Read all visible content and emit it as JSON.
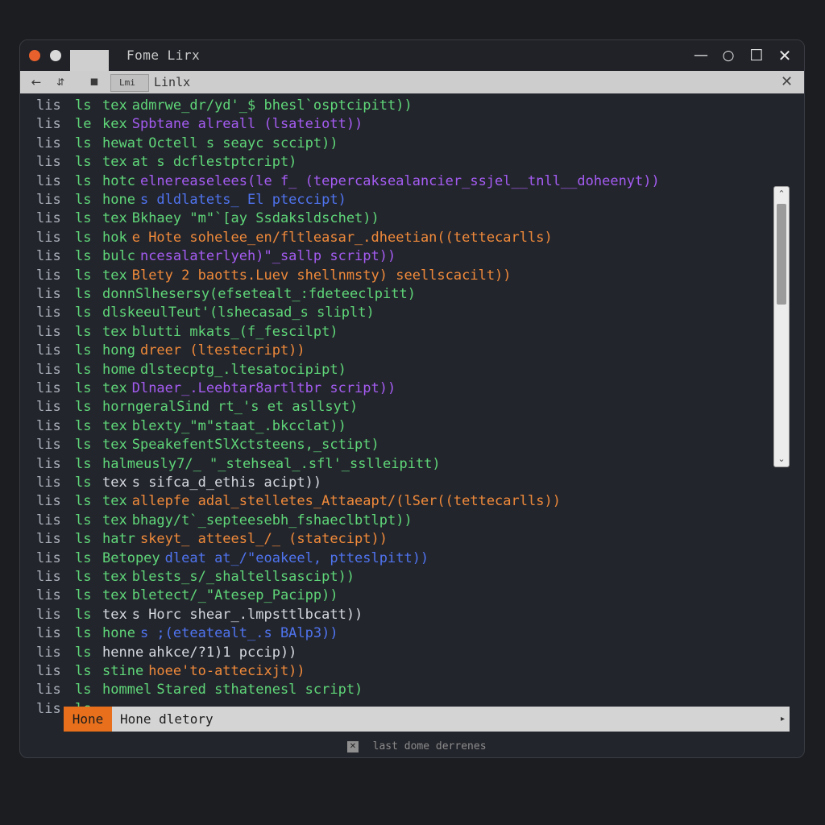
{
  "window": {
    "title": "Fome Lirx",
    "controls": {
      "minimize": "—",
      "restore": "○",
      "maximize": "☐",
      "close": "✕"
    }
  },
  "toolbar": {
    "back": "←",
    "forward": "⇵",
    "view": "◼",
    "tab_text": "Lmi",
    "label": "Linlx",
    "close": "✕"
  },
  "colors": {
    "green": "#5fd779",
    "purple": "#a45cf2",
    "orange": "#f08a3a",
    "blue": "#4f74f0",
    "white": "#d6dae0",
    "accent": "#e8701c"
  },
  "terminal": {
    "lines": [
      {
        "prompt": "lis",
        "cmd": "ls",
        "arg": "tex",
        "rest": "admrwe_dr/yd'_$ bhesl`osptcipitt))",
        "color": "green"
      },
      {
        "prompt": "lis",
        "cmd": "le",
        "arg": "kex",
        "rest": "Spbtane alreall (lsateiott))",
        "color": "purple"
      },
      {
        "prompt": "lis",
        "cmd": "ls",
        "arg": "hewat",
        "rest": "Octell s seayc sccipt))",
        "color": "green"
      },
      {
        "prompt": "lis",
        "cmd": "ls",
        "arg": "tex",
        "rest": "at s dcflestptcript)",
        "color": "green"
      },
      {
        "prompt": "lis",
        "cmd": "ls",
        "arg": "hotc",
        "rest": "elnereaselees(le f_ (tepercaksealancier_ssjel__tnll__doheenyt))",
        "color": "purple"
      },
      {
        "prompt": "lis",
        "cmd": "ls",
        "arg": "hone",
        "rest": "s dldlatets_ El pteccipt)",
        "color": "blue"
      },
      {
        "prompt": "lis",
        "cmd": "ls",
        "arg": "tex",
        "rest": "Bkhaey \"m\"`[ay Ssdaksldschet))",
        "color": "green"
      },
      {
        "prompt": "lis",
        "cmd": "ls",
        "arg": "hok",
        "rest": "e Hote sohelee_en/fltleasar_.dheetian((tettecarlls)",
        "color": "orange"
      },
      {
        "prompt": "lis",
        "cmd": "ls",
        "arg": "bulc",
        "rest": "ncesalaterlyeh)\"_sallp script))",
        "color": "purple"
      },
      {
        "prompt": "lis",
        "cmd": "ls",
        "arg": "tex",
        "rest": "Blety 2 baotts.Luev shellnmsty) seellscacilt))",
        "color": "orange"
      },
      {
        "prompt": "lis",
        "cmd": "ls",
        "arg": "donnSlhesersy(efsetealt_:fdeteeclpitt)",
        "rest": "",
        "color": "green"
      },
      {
        "prompt": "lis",
        "cmd": "ls",
        "arg": "dlskeeulTeut'(lshecasad_s sliplt)",
        "rest": "",
        "color": "green"
      },
      {
        "prompt": "lis",
        "cmd": "ls",
        "arg": "tex",
        "rest": "blutti mkats_(f_fescilpt)",
        "color": "green"
      },
      {
        "prompt": "lis",
        "cmd": "ls",
        "arg": "hong",
        "rest": "dreer (ltestecript))",
        "color": "orange"
      },
      {
        "prompt": "lis",
        "cmd": "ls",
        "arg": "home",
        "rest": "dlstecptg_.ltesatocipipt)",
        "color": "green"
      },
      {
        "prompt": "lis",
        "cmd": "ls",
        "arg": "tex",
        "rest": "Dlnaer_.Leebtar8artltbr script))",
        "color": "purple"
      },
      {
        "prompt": "lis",
        "cmd": "ls",
        "arg": "horngeralSind rt_'s et asllsyt)",
        "rest": "",
        "color": "purple"
      },
      {
        "prompt": "lis",
        "cmd": "ls",
        "arg": "tex",
        "rest": "blexty_\"m\"staat_.bkcclat))",
        "color": "green"
      },
      {
        "prompt": "lis",
        "cmd": "ls",
        "arg": "tex",
        "rest": "SpeakefentSlXctsteens,_sctipt)",
        "color": "green"
      },
      {
        "prompt": "lis",
        "cmd": "ls",
        "arg": "halmeusly7/_ \"_stehseal_.sfl'_sslleipitt)",
        "rest": "",
        "color": "green"
      },
      {
        "prompt": "lis",
        "cmd": "ls",
        "arg": "tex",
        "rest": "s sifca_d_ethis acipt))",
        "color": "white"
      },
      {
        "prompt": "lis",
        "cmd": "ls",
        "arg": "tex",
        "rest": "allepfe adal_stelletes_Attaeapt/(lSer((tettecarlls))",
        "color": "orange"
      },
      {
        "prompt": "lis",
        "cmd": "ls",
        "arg": "tex",
        "rest": "bhagy/t`_septeesebh_fshaeclbtlpt))",
        "color": "green"
      },
      {
        "prompt": "lis",
        "cmd": "ls",
        "arg": "hatr",
        "rest": "skeyt_ atteesl_/_ (statecipt))",
        "color": "orange"
      },
      {
        "prompt": "lis",
        "cmd": "ls",
        "arg": "Betopey",
        "rest": "dleat at_/\"eoakeel, ptteslpitt))",
        "color": "blue"
      },
      {
        "prompt": "lis",
        "cmd": "ls",
        "arg": "tex",
        "rest": "blests_s/_shaltellsascipt))",
        "color": "green"
      },
      {
        "prompt": "lis",
        "cmd": "ls",
        "arg": "tex",
        "rest": "bletect/_\"Atesep_Pacipp))",
        "color": "green"
      },
      {
        "prompt": "lis",
        "cmd": "ls",
        "arg": "tex",
        "rest": "s Horc shear_.lmpsttlbcatt))",
        "color": "white"
      },
      {
        "prompt": "lis",
        "cmd": "ls",
        "arg": "hone",
        "rest": "s ;(eteatealt_.s BAlp3))",
        "color": "blue"
      },
      {
        "prompt": "lis",
        "cmd": "ls",
        "arg": "henne",
        "rest": "ahkce/?1)1 pccip))",
        "color": "white"
      },
      {
        "prompt": "lis",
        "cmd": "ls",
        "arg": "stine",
        "rest": "hoee'to-attecixjt))",
        "color": "orange"
      },
      {
        "prompt": "lis",
        "cmd": "ls",
        "arg": "hommel",
        "rest": "Stared sthatenesl script)",
        "color": "green"
      },
      {
        "prompt": "lis",
        "cmd": "ls",
        "arg": "",
        "rest": "",
        "color": "white"
      }
    ]
  },
  "scrollbar": {
    "up": "⌃",
    "down": "⌄",
    "position": 0.05
  },
  "statusbar": {
    "tag": "Hone",
    "text": "Hone dletory",
    "arrow": "▸"
  },
  "footer": {
    "icon": "✕",
    "text": "last dome derrenes"
  }
}
